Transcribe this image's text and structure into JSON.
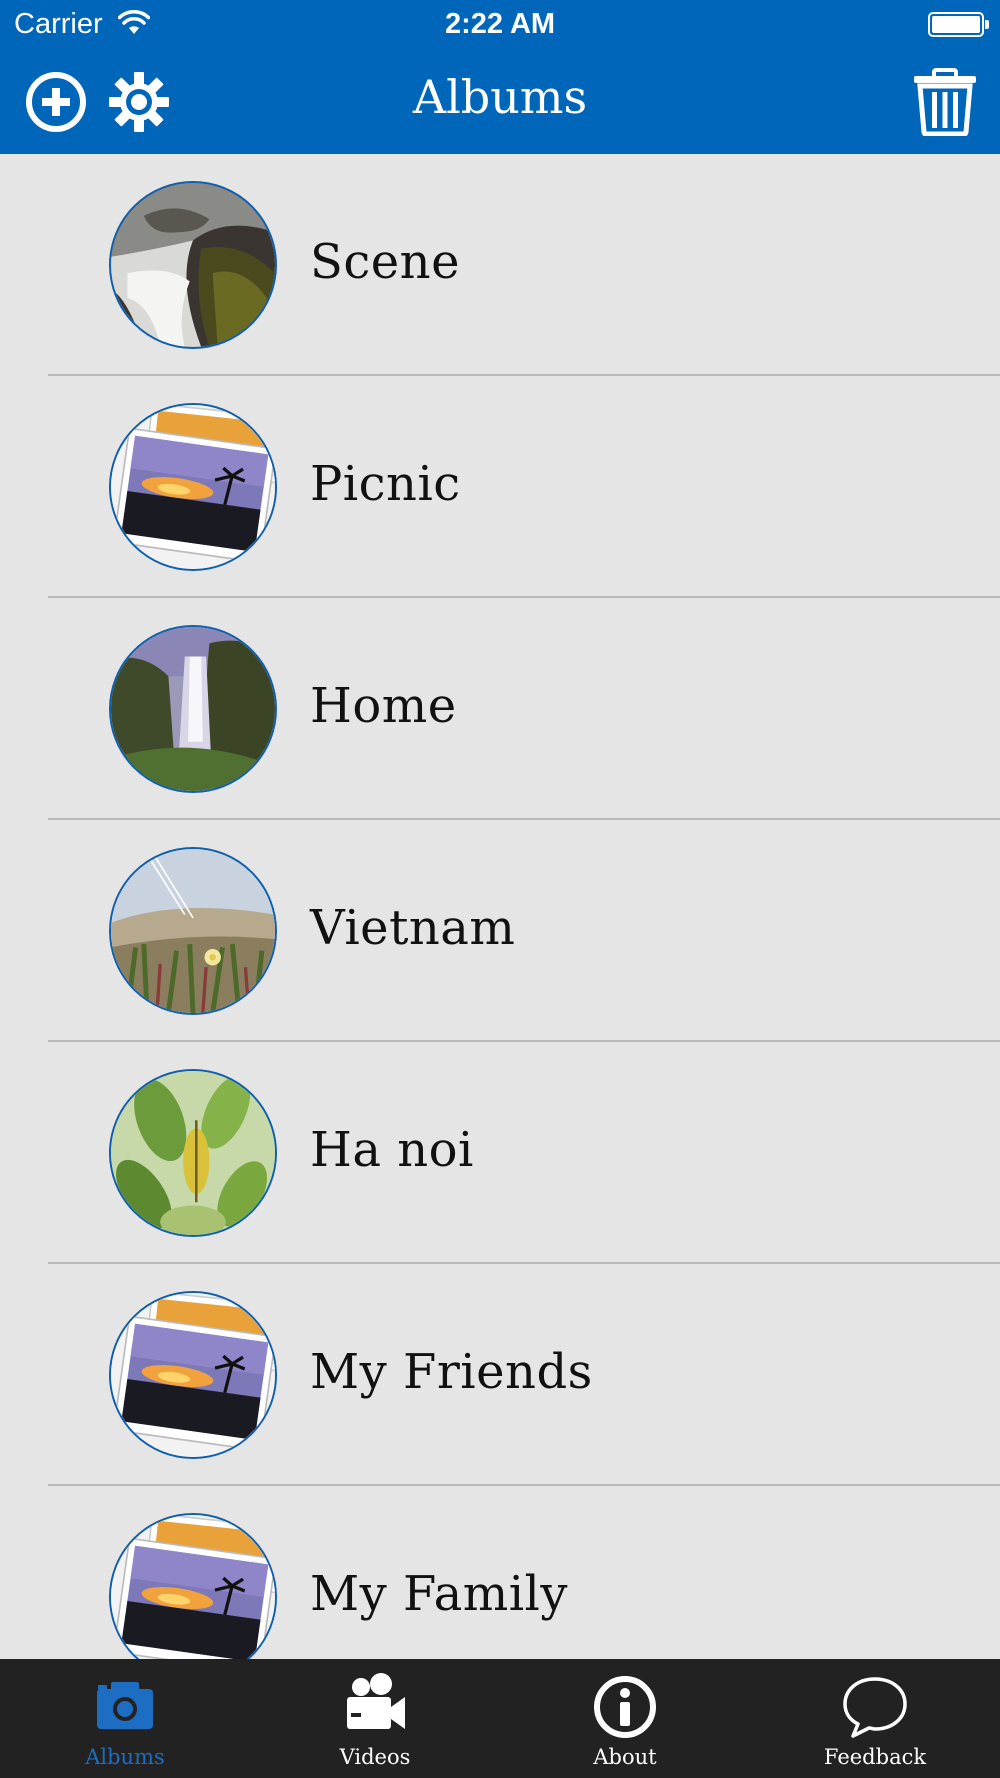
{
  "status_bar": {
    "carrier": "Carrier",
    "time": "2:22 AM"
  },
  "nav_bar": {
    "title": "Albums",
    "background_color": "#0066b9",
    "left_icons": [
      "add-circle-icon",
      "gear-icon"
    ],
    "right_icons": [
      "trash-icon"
    ]
  },
  "albums": [
    {
      "name": "Scene",
      "thumbnail": "waterfall-rocks-photo"
    },
    {
      "name": "Picnic",
      "thumbnail": "photo-stack-sunset"
    },
    {
      "name": "Home",
      "thumbnail": "waterfall-valley-photo"
    },
    {
      "name": "Vietnam",
      "thumbnail": "beach-grass-flower-photo"
    },
    {
      "name": "Ha noi",
      "thumbnail": "green-leaves-photo"
    },
    {
      "name": "My Friends",
      "thumbnail": "photo-stack-sunset"
    },
    {
      "name": "My Family",
      "thumbnail": "photo-stack-sunset"
    }
  ],
  "tab_bar": {
    "tabs": [
      {
        "label": "Albums",
        "icon": "camera-icon",
        "active": true
      },
      {
        "label": "Videos",
        "icon": "video-camera-icon",
        "active": false
      },
      {
        "label": "About",
        "icon": "info-icon",
        "active": false
      },
      {
        "label": "Feedback",
        "icon": "speech-bubble-icon",
        "active": false
      }
    ],
    "active_color": "#1d6ec2",
    "inactive_color": "#ffffff"
  }
}
